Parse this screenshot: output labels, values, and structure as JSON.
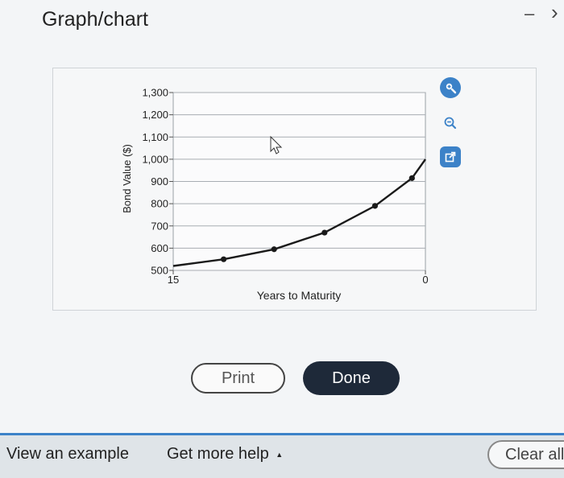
{
  "window": {
    "title": "Graph/chart",
    "minimize_glyph": "–",
    "next_glyph": "›"
  },
  "chart_data": {
    "type": "line",
    "xlabel": "Years to Maturity",
    "ylabel": "Bond Value ($)",
    "x_ticks": [
      "15",
      "0"
    ],
    "xlim": [
      15,
      0
    ],
    "ylim": [
      500,
      1300
    ],
    "y_ticks": [
      "500",
      "600",
      "700",
      "800",
      "900",
      "1,000",
      "1,100",
      "1,200",
      "1,300"
    ],
    "x": [
      15,
      12,
      9,
      6,
      3,
      0.8,
      0
    ],
    "values": [
      520,
      550,
      595,
      670,
      790,
      915,
      1000
    ],
    "marker_x": [
      12,
      9,
      6,
      3,
      0.8
    ],
    "grid": true,
    "line_color": "#1a1a1a"
  },
  "tools": {
    "zoom_in": "zoom-in-icon",
    "zoom_out": "zoom-out-icon",
    "open_external": "external-link-icon"
  },
  "buttons": {
    "print": "Print",
    "done": "Done"
  },
  "footer": {
    "view_example": "View an example",
    "get_more_help": "Get more help",
    "help_caret": "▲",
    "clear_all": "Clear all"
  },
  "colors": {
    "accent": "#3c82c8",
    "done_bg": "#1e2939"
  }
}
